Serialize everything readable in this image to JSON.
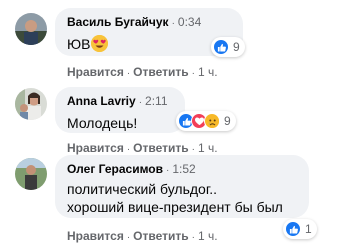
{
  "comments": [
    {
      "author": "Василь Бугайчук",
      "time": "0:34",
      "text": "ЮВ",
      "emoji_icon": "heart-eyes-emoji-icon",
      "reaction_icons": [
        "like-icon"
      ],
      "reaction_count": "9",
      "actions": {
        "like": "Нравится",
        "reply": "Ответить",
        "ago": "1 ч."
      }
    },
    {
      "author": "Anna Lavriy",
      "time": "2:11",
      "text": "Молодець!",
      "reaction_icons": [
        "like-icon",
        "love-icon",
        "sad-icon"
      ],
      "reaction_count": "9",
      "actions": {
        "like": "Нравится",
        "reply": "Ответить",
        "ago": "1 ч."
      }
    },
    {
      "author": "Олег Герасимов",
      "time": "1:52",
      "text_line1": "политический бульдог..",
      "text_line2": "хороший вице-президент бы был",
      "reaction_icons": [
        "like-icon"
      ],
      "reaction_count": "1",
      "actions": {
        "like": "Нравится",
        "reply": "Ответить",
        "ago": "1 ч."
      }
    }
  ],
  "colors": {
    "bubble": "#f0f2f5",
    "secondary_text": "#65676b",
    "like_blue": "#1877f2",
    "love_red": "#f33e58",
    "sad_yellow": "#f7b928"
  }
}
